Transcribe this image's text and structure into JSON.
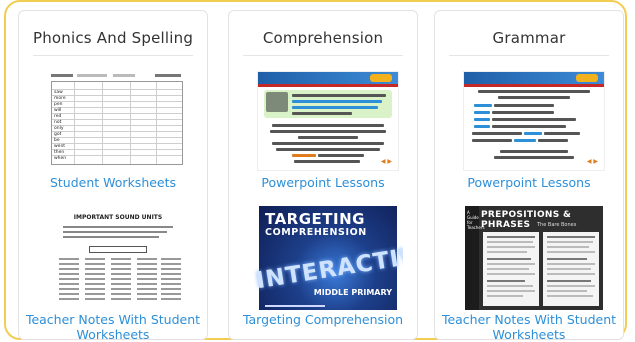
{
  "columns": [
    {
      "title": "Phonics And Spelling",
      "top_link": "Student Worksheets",
      "bottom_link": "Teacher Notes With Student Worksheets",
      "bottom_thumb_title": "IMPORTANT SOUND UNITS"
    },
    {
      "title": "Comprehension",
      "top_link": "Powerpoint Lessons",
      "bottom_link": "Targeting Comprehension",
      "cover_title_1": "TARGETING",
      "cover_title_2": "COMPREHENSION",
      "cover_big": "INTERACTIVELY",
      "cover_level": "MIDDLE PRIMARY"
    },
    {
      "title": "Grammar",
      "top_link": "Powerpoint Lessons",
      "bottom_link": "Teacher Notes With Student Worksheets",
      "poster_title": "PREPOSITIONS & PHRASES",
      "poster_subtitle": "The Bare Bones"
    }
  ],
  "worksheet_words": [
    "saw",
    "more",
    "pen",
    "will",
    "red",
    "not",
    "only",
    "got",
    "be",
    "went",
    "then",
    "when"
  ],
  "colors": {
    "frame_border": "#f1cd52",
    "link": "#2d8fd8",
    "title_text": "#333333"
  }
}
